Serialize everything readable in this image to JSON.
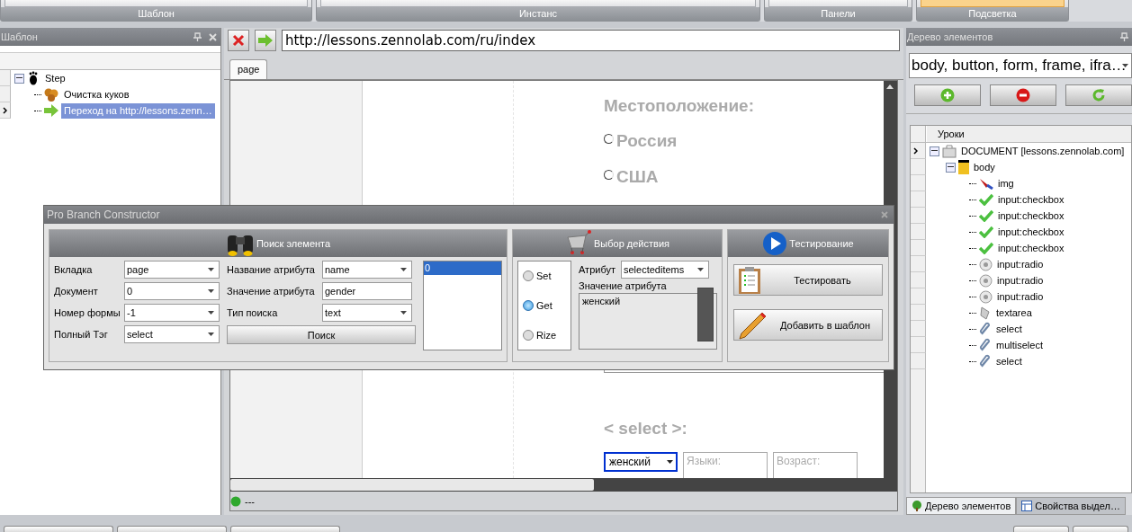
{
  "ribbon": {
    "groups": [
      {
        "label": "Шаблон",
        "highlighted": false
      },
      {
        "label": "Инстанс",
        "highlighted": false
      },
      {
        "label": "Панели",
        "highlighted": false
      },
      {
        "label": "Подсветка",
        "highlighted": true
      }
    ]
  },
  "template_panel": {
    "title": "Шаблон",
    "tree": [
      {
        "label": "Step",
        "kind": "step",
        "expanded": true,
        "selected": false,
        "children": [
          {
            "label": "Очистка куков",
            "kind": "cookies",
            "selected": false
          },
          {
            "label": "Переход на http://lessons.zenn…",
            "kind": "goto",
            "selected": true
          }
        ]
      }
    ]
  },
  "browser": {
    "url": "http://lessons.zennolab.com/ru/index",
    "tabs": [
      {
        "label": "page",
        "selected": true
      }
    ],
    "page": {
      "heading": "Местоположение:",
      "radios": [
        {
          "label": "Россия",
          "checked": false
        },
        {
          "label": "США",
          "checked": false
        }
      ],
      "select_heading": "< select >:",
      "select_value": "женский",
      "fields": [
        {
          "label": "Языки:"
        },
        {
          "label": "Возраст:"
        }
      ]
    },
    "status": "---"
  },
  "dialog": {
    "title": "Pro Branch Constructor",
    "search": {
      "title": "Поиск элемента",
      "fields": [
        {
          "label": "Вкладка",
          "value": "page",
          "kind": "dropdown"
        },
        {
          "label": "Документ",
          "value": "0",
          "kind": "dropdown"
        },
        {
          "label": "Номер формы",
          "value": "-1",
          "kind": "dropdown"
        },
        {
          "label": "Полный Тэг",
          "value": "select",
          "kind": "dropdown"
        }
      ],
      "attr_fields": [
        {
          "label": "Название атрибута",
          "value": "name",
          "kind": "dropdown"
        },
        {
          "label": "Значение атрибута",
          "value": "gender",
          "kind": "text"
        },
        {
          "label": "Тип поиска",
          "value": "text",
          "kind": "dropdown"
        }
      ],
      "button": "Поиск",
      "results": [
        {
          "label": "0",
          "selected": true
        }
      ]
    },
    "action": {
      "title": "Выбор действия",
      "modes": [
        {
          "label": "Set",
          "selected": false
        },
        {
          "label": "Get",
          "selected": true
        },
        {
          "label": "Rize",
          "selected": false
        }
      ],
      "attribute_label": "Атрибут",
      "attribute_value": "selecteditems",
      "value_label": "Значение атрибута",
      "value": "женский"
    },
    "testing": {
      "title": "Тестирование",
      "buttons": [
        {
          "label": "Тестировать",
          "kind": "test"
        },
        {
          "label": "Добавить в шаблон",
          "kind": "add"
        }
      ]
    }
  },
  "elements_panel": {
    "title": "Дерево элементов",
    "filter": "body, button, form, frame, ifra…",
    "column": "Уроки",
    "tree": [
      {
        "label": "DOCUMENT [lessons.zennolab.com]",
        "kind": "document",
        "expanded": true,
        "children": [
          {
            "label": "body",
            "kind": "body",
            "expanded": true,
            "children": [
              {
                "label": "img",
                "kind": "img"
              },
              {
                "label": "input:checkbox",
                "kind": "checkbox"
              },
              {
                "label": "input:checkbox",
                "kind": "checkbox"
              },
              {
                "label": "input:checkbox",
                "kind": "checkbox"
              },
              {
                "label": "input:checkbox",
                "kind": "checkbox"
              },
              {
                "label": "input:radio",
                "kind": "radio"
              },
              {
                "label": "input:radio",
                "kind": "radio"
              },
              {
                "label": "input:radio",
                "kind": "radio"
              },
              {
                "label": "textarea",
                "kind": "textarea"
              },
              {
                "label": "select",
                "kind": "select"
              },
              {
                "label": "multiselect",
                "kind": "select"
              },
              {
                "label": "select",
                "kind": "select"
              }
            ]
          }
        ]
      }
    ],
    "tabs": [
      {
        "label": "Дерево элементов",
        "selected": true
      },
      {
        "label": "Свойства выдел…",
        "selected": false
      }
    ]
  }
}
